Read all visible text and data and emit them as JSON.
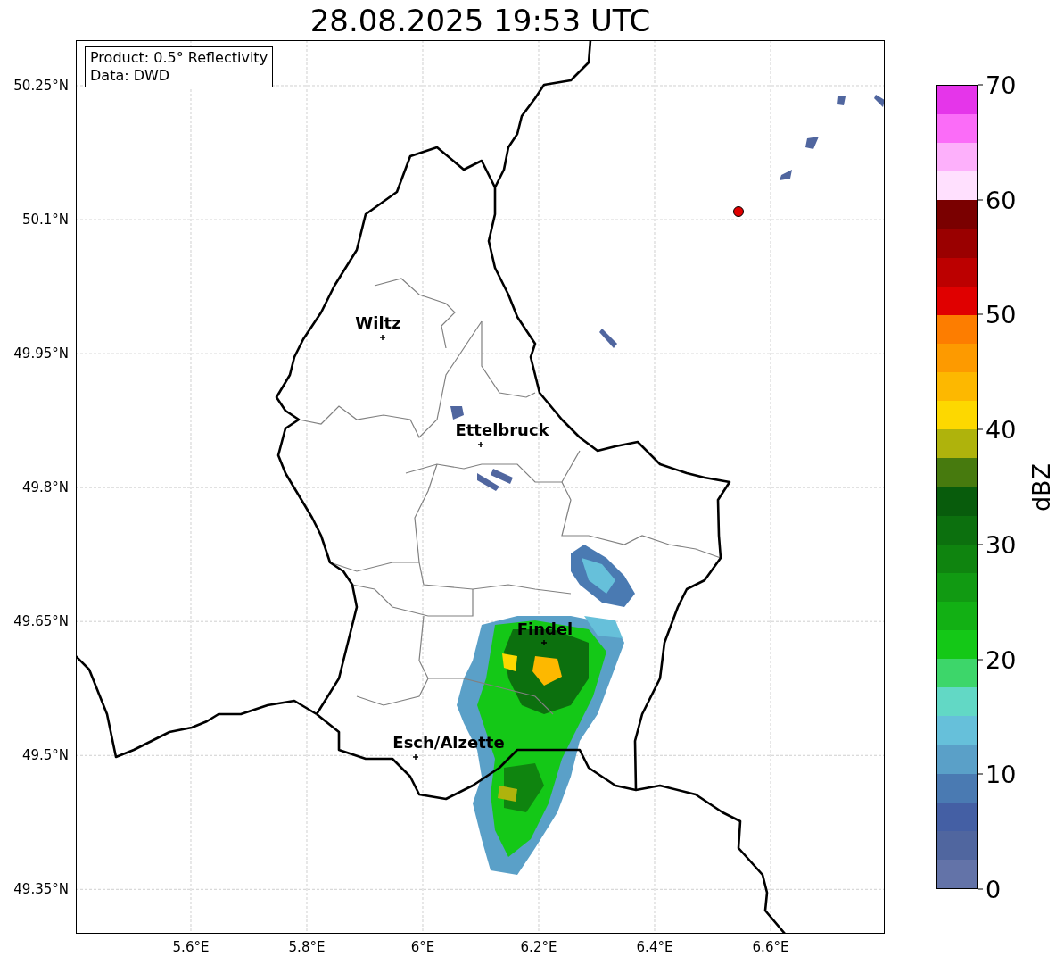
{
  "title": "28.08.2025 19:53 UTC",
  "info_box": [
    "Product: 0.5° Reflectivity",
    "Data: DWD"
  ],
  "lat_ticks": [
    "50.25°N",
    "50.1°N",
    "49.95°N",
    "49.8°N",
    "49.65°N",
    "49.5°N",
    "49.35°N"
  ],
  "lon_ticks": [
    "5.6°E",
    "5.8°E",
    "6°E",
    "6.2°E",
    "6.4°E",
    "6.6°E"
  ],
  "places": [
    {
      "name": "Wiltz"
    },
    {
      "name": "Ettelbruck"
    },
    {
      "name": "Findel"
    },
    {
      "name": "Esch/Alzette"
    }
  ],
  "colorbar": {
    "label": "dBZ",
    "ticks": [
      "70",
      "60",
      "50",
      "40",
      "30",
      "20",
      "10",
      "0"
    ],
    "bins": [
      {
        "color": "#6373a8"
      },
      {
        "color": "#50669f"
      },
      {
        "color": "#445fa4"
      },
      {
        "color": "#4a7ab2"
      },
      {
        "color": "#5aa0c8"
      },
      {
        "color": "#66c0da"
      },
      {
        "color": "#62d8c5"
      },
      {
        "color": "#3dd66a"
      },
      {
        "color": "#14c817"
      },
      {
        "color": "#12b014"
      },
      {
        "color": "#119a12"
      },
      {
        "color": "#0f840f"
      },
      {
        "color": "#0c700e"
      },
      {
        "color": "#085c0c"
      },
      {
        "color": "#477a0e"
      },
      {
        "color": "#afb30c"
      },
      {
        "color": "#fdd800"
      },
      {
        "color": "#fdb800"
      },
      {
        "color": "#fd9a00"
      },
      {
        "color": "#fd7d00"
      },
      {
        "color": "#e00000"
      },
      {
        "color": "#bc0000"
      },
      {
        "color": "#9a0000"
      },
      {
        "color": "#7a0000"
      },
      {
        "color": "#ffe0fe"
      },
      {
        "color": "#fdb0fb"
      },
      {
        "color": "#fb6cf8"
      },
      {
        "color": "#e535ea"
      }
    ]
  }
}
